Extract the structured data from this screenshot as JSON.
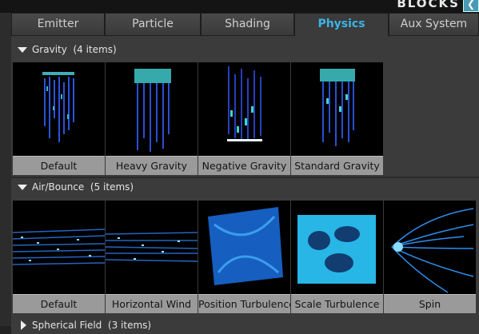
{
  "header": {
    "title": "BLOCKS",
    "button_icon": "back-arrow-icon"
  },
  "tabs": [
    {
      "label": "Emitter",
      "active": false
    },
    {
      "label": "Particle",
      "active": false
    },
    {
      "label": "Shading",
      "active": false
    },
    {
      "label": "Physics",
      "active": true
    },
    {
      "label": "Aux System",
      "active": false
    }
  ],
  "sections": [
    {
      "title": "Gravity  (4 items)",
      "expanded": true,
      "items": [
        {
          "label": "Default"
        },
        {
          "label": "Heavy Gravity"
        },
        {
          "label": "Negative Gravity"
        },
        {
          "label": "Standard Gravity"
        }
      ]
    },
    {
      "title": "Air/Bounce  (5 items)",
      "expanded": true,
      "items": [
        {
          "label": "Default"
        },
        {
          "label": "Horizontal Wind"
        },
        {
          "label": "Position Turbulence"
        },
        {
          "label": "Scale Turbulence"
        },
        {
          "label": "Spin"
        }
      ]
    },
    {
      "title": "Spherical Field  (3 items)",
      "expanded": false,
      "items": []
    }
  ],
  "colors": {
    "accent": "#3ab4e6",
    "caption_bg": "#9a9a9a",
    "panel_bg": "#3b3b3b"
  }
}
